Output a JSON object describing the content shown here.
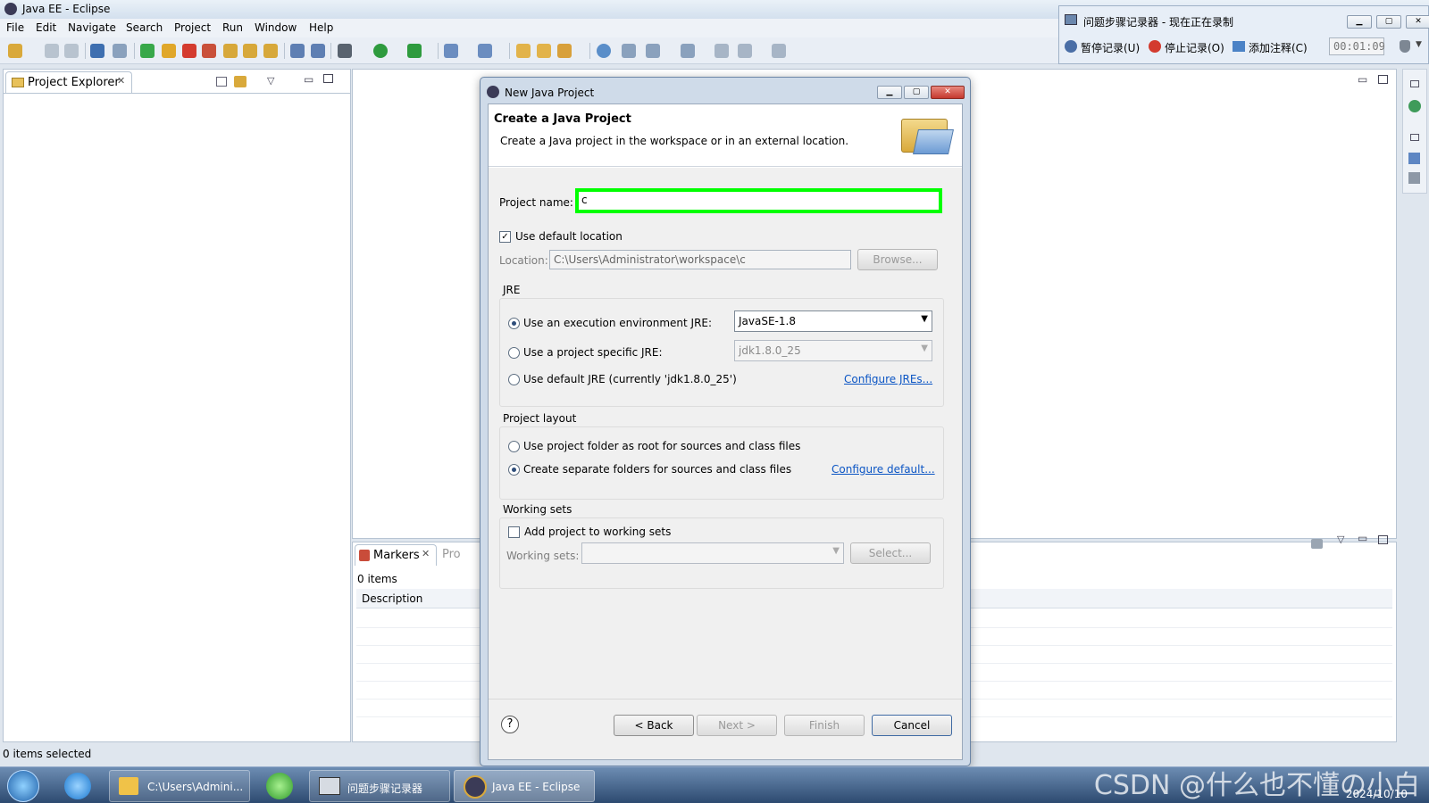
{
  "window": {
    "title": "Java EE - Eclipse"
  },
  "menu": [
    "File",
    "Edit",
    "Navigate",
    "Search",
    "Project",
    "Run",
    "Window",
    "Help"
  ],
  "project_explorer": {
    "tab_label": "Project Explorer"
  },
  "markers": {
    "tab_label": "Markers",
    "second_tab_label": "Pro",
    "count_text": "0 items",
    "column": "Description"
  },
  "status": {
    "text": "0 items selected"
  },
  "steps_recorder": {
    "title": "问题步骤记录器 - 现在正在录制",
    "pause": "暂停记录(U)",
    "stop": "停止记录(O)",
    "comment": "添加注释(C)",
    "timer": "00:01:09"
  },
  "dialog": {
    "title": "New Java Project",
    "heading": "Create a Java Project",
    "description": "Create a Java project in the workspace or in an external location.",
    "project_name_label": "Project name:",
    "project_name_value": "c",
    "use_default_location": "Use default location",
    "location_label": "Location:",
    "location_value": "C:\\Users\\Administrator\\workspace\\c",
    "browse": "Browse...",
    "jre": {
      "group": "JRE",
      "opt_env": "Use an execution environment JRE:",
      "env_value": "JavaSE-1.8",
      "opt_specific": "Use a project specific JRE:",
      "specific_value": "jdk1.8.0_25",
      "opt_default": "Use default JRE (currently 'jdk1.8.0_25')",
      "configure": "Configure JREs..."
    },
    "layout": {
      "group": "Project layout",
      "opt_root": "Use project folder as root for sources and class files",
      "opt_separate": "Create separate folders for sources and class files",
      "configure": "Configure default..."
    },
    "working_sets": {
      "group": "Working sets",
      "add": "Add project to working sets",
      "label": "Working sets:",
      "select": "Select..."
    },
    "buttons": {
      "back": "< Back",
      "next": "Next >",
      "finish": "Finish",
      "cancel": "Cancel",
      "help": "?"
    }
  },
  "taskbar": {
    "items": [
      "C:\\Users\\Admini...",
      "问题步骤记录器",
      "Java EE - Eclipse"
    ],
    "watermark": "CSDN @什么也不懂の小白",
    "date": "2024/10/10"
  },
  "colors": {
    "highlight": "#00ff00",
    "link": "#0b55c4",
    "close": "#d9443a"
  }
}
